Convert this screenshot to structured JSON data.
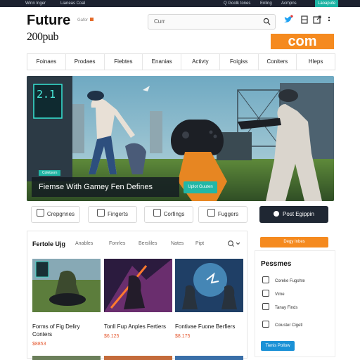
{
  "topbar": {
    "left_a": "Winn Inger",
    "left_b": "Lianeas Coal",
    "right_a": "Q Goolk tones",
    "right_b": "Enling",
    "right_c": "Acmpns",
    "right_tag": "Laoapute"
  },
  "header": {
    "logo_line1": "Future",
    "logo_line2": "200pub",
    "badge": "Gafor",
    "search_placeholder": "Curr"
  },
  "banner": {
    "text": "com"
  },
  "nav": [
    "Foinaes",
    "Prodaes",
    "Fiebtes",
    "Enanias",
    "Activty",
    "Foigiss",
    "Coniters",
    "Hleps"
  ],
  "hero": {
    "tag": "Coletsorn",
    "title": "Fiemse With Gamey Fen Defines",
    "button": "Uplot Guuten",
    "logo_text": "2.1"
  },
  "subnav": [
    {
      "label": "Crepgnnes"
    },
    {
      "label": "Fingerts"
    },
    {
      "label": "Corfings"
    },
    {
      "label": "Fuggers"
    }
  ],
  "dark_button": "Post Egippin",
  "products": {
    "title": "Fertole Ujg",
    "tabs": [
      "Anables",
      "Fonrles",
      "Bersliles",
      "Nates",
      "Pipt"
    ],
    "cards": [
      {
        "title": "Forms of Fig Deliry Conters",
        "price": "$8853"
      },
      {
        "title": "Tonll Fup Anples Fertiers",
        "price": "$6.125"
      },
      {
        "title": "Fontivae Fuone Berfiers",
        "price": "$8.175"
      }
    ]
  },
  "sidebar": {
    "top_button": "Degy Inbes",
    "heading": "Pessmes",
    "items": [
      {
        "label": "Coreke Fugshte"
      },
      {
        "label": "Vime"
      },
      {
        "label": "Tanay Finds"
      },
      {
        "label": "Coiuster Cigetl"
      }
    ],
    "bottom_button": "Tienis Pollow"
  },
  "colors": {
    "accent_orange": "#f58a1f",
    "accent_teal": "#22b7a6",
    "dark": "#1f2733",
    "price": "#e4572e"
  }
}
